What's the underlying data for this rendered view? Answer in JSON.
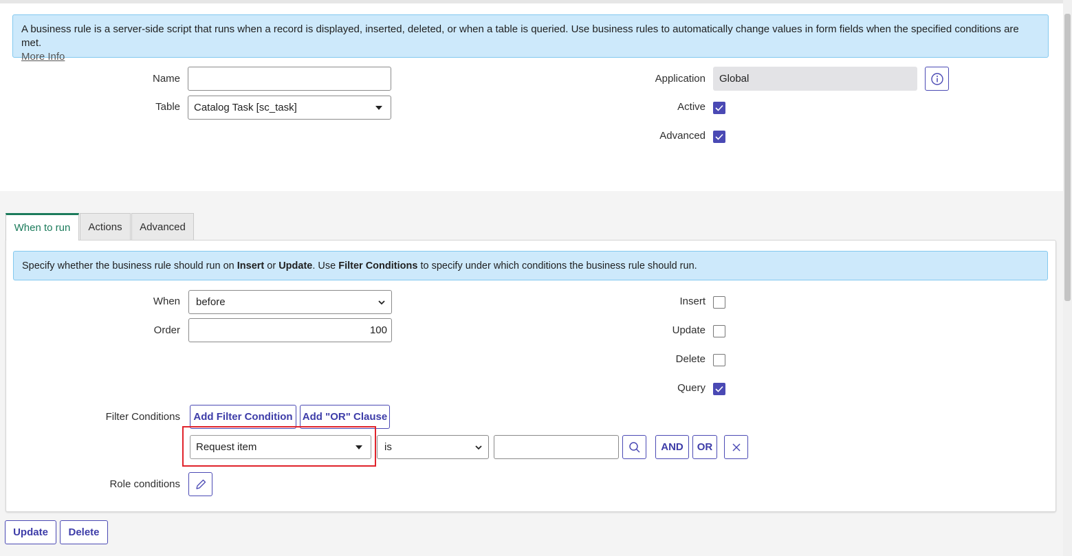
{
  "info_banner": {
    "text": "A business rule is a server-side script that runs when a record is displayed, inserted, deleted, or when a table is queried. Use business rules to automatically change values in form fields when the specified conditions are met.",
    "link": "More Info"
  },
  "form": {
    "name_label": "Name",
    "name_value": "",
    "table_label": "Table",
    "table_value": "Catalog Task [sc_task]",
    "application_label": "Application",
    "application_value": "Global",
    "active_label": "Active",
    "active_checked": true,
    "advanced_label": "Advanced",
    "advanced_checked": true
  },
  "tabs": [
    {
      "label": "When to run",
      "active": true
    },
    {
      "label": "Actions",
      "active": false
    },
    {
      "label": "Advanced",
      "active": false
    }
  ],
  "tab_info": {
    "p1": "Specify whether the business rule should run on ",
    "b1": "Insert",
    "p2": " or ",
    "b2": "Update",
    "p3": ". Use ",
    "b3": "Filter Conditions",
    "p4": " to specify under which conditions the business rule should run."
  },
  "when_to_run": {
    "when_label": "When",
    "when_value": "before",
    "order_label": "Order",
    "order_value": "100",
    "insert_label": "Insert",
    "insert_checked": false,
    "update_label": "Update",
    "update_checked": false,
    "delete_label": "Delete",
    "delete_checked": false,
    "query_label": "Query",
    "query_checked": true,
    "filter_label": "Filter Conditions",
    "add_filter_label": "Add Filter Condition",
    "add_or_label": "Add \"OR\" Clause",
    "condition_field": "Request item",
    "condition_operator": "is",
    "condition_value": "",
    "and_label": "AND",
    "or_label": "OR",
    "role_label": "Role conditions"
  },
  "footer": {
    "update_label": "Update",
    "delete_label": "Delete"
  },
  "colors": {
    "accent": "#4a49b4",
    "tab_active": "#1b7b5b",
    "info_bg": "#cde9fb",
    "highlight": "#e0232b"
  }
}
